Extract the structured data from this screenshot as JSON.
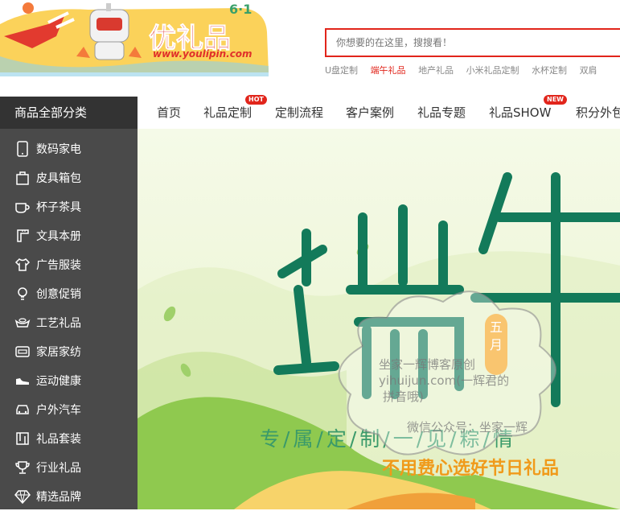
{
  "header": {
    "logo_text": "优礼品",
    "logo_badge": "6·1",
    "logo_url": "www.youlipin.com",
    "search_placeholder": "你想要的在这里，搜搜看！",
    "hot_words": [
      "U盘定制",
      "端午礼品",
      "地产礼品",
      "小米礼品定制",
      "水杯定制",
      "双肩"
    ],
    "hot_active_index": 1
  },
  "category_header": "商品全部分类",
  "categories": [
    {
      "label": "数码家电",
      "icon": "phone-icon"
    },
    {
      "label": "皮具箱包",
      "icon": "bag-icon"
    },
    {
      "label": "杯子茶具",
      "icon": "cup-icon"
    },
    {
      "label": "文具本册",
      "icon": "ruler-icon"
    },
    {
      "label": "广告服装",
      "icon": "shirt-icon"
    },
    {
      "label": "创意促销",
      "icon": "bulb-icon"
    },
    {
      "label": "工艺礼品",
      "icon": "ingot-icon"
    },
    {
      "label": "家居家纺",
      "icon": "home-appliance-icon"
    },
    {
      "label": "运动健康",
      "icon": "shoe-icon"
    },
    {
      "label": "户外汽车",
      "icon": "car-icon"
    },
    {
      "label": "礼品套装",
      "icon": "gift-set-icon"
    },
    {
      "label": "行业礼品",
      "icon": "trophy-icon"
    },
    {
      "label": "精选品牌",
      "icon": "diamond-icon"
    }
  ],
  "nav": [
    {
      "label": "首页"
    },
    {
      "label": "礼品定制",
      "badge": "HOT"
    },
    {
      "label": "定制流程"
    },
    {
      "label": "客户案例"
    },
    {
      "label": "礼品专题"
    },
    {
      "label": "礼品SHOW",
      "badge": "NEW"
    },
    {
      "label": "积分外包"
    }
  ],
  "banner": {
    "title_chars": [
      "端",
      "午"
    ],
    "month_label": "五月",
    "tagline": "专/属/定/制/一/见/粽/情",
    "subline": "不用费心选好节日礼品",
    "watermark": [
      "坐家一辉博客原创",
      "yihuijun.com(一辉君的",
      "拼音哦)",
      "微信公众号：坐家一辉"
    ]
  },
  "colors": {
    "accent": "#e1251b",
    "sidebar": "#4a4a4a",
    "green": "#137a5a",
    "orange": "#f09a1a"
  }
}
